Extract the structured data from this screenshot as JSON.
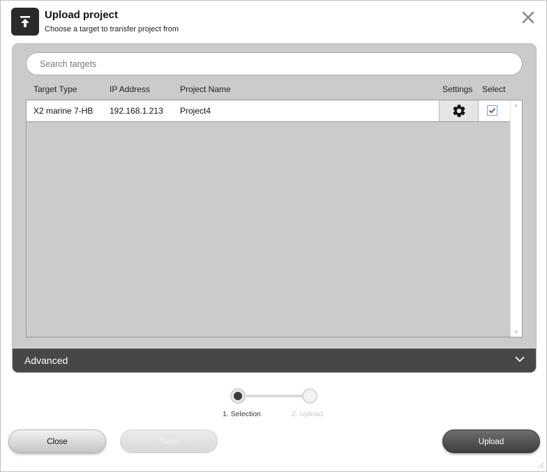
{
  "header": {
    "title": "Upload project",
    "subtitle": "Choose a target to transfer project from",
    "icon": "upload-icon",
    "close_icon": "close-icon"
  },
  "search": {
    "placeholder": "Search targets",
    "value": ""
  },
  "table": {
    "columns": {
      "target_type": "Target Type",
      "ip_address": "IP Address",
      "project_name": "Project Name",
      "settings": "Settings",
      "select": "Select"
    },
    "rows": [
      {
        "target_type": "X2 marine 7-HB",
        "ip_address": "192.168.1.213",
        "project_name": "Project4",
        "settings_icon": "gear-icon",
        "selected": true
      }
    ]
  },
  "advanced": {
    "label": "Advanced",
    "icon": "chevron-down-icon"
  },
  "stepper": {
    "steps": [
      {
        "label": "1. Selection",
        "active": true
      },
      {
        "label": "2. Upload",
        "active": false
      }
    ]
  },
  "buttons": {
    "close": "Close",
    "next": "Next",
    "upload": "Upload"
  },
  "colors": {
    "panel_bg": "#cbcbcb",
    "advanced_bar": "#474747",
    "primary_button": "#4a4a4a",
    "step_inactive_text": "#c8c8c8"
  }
}
